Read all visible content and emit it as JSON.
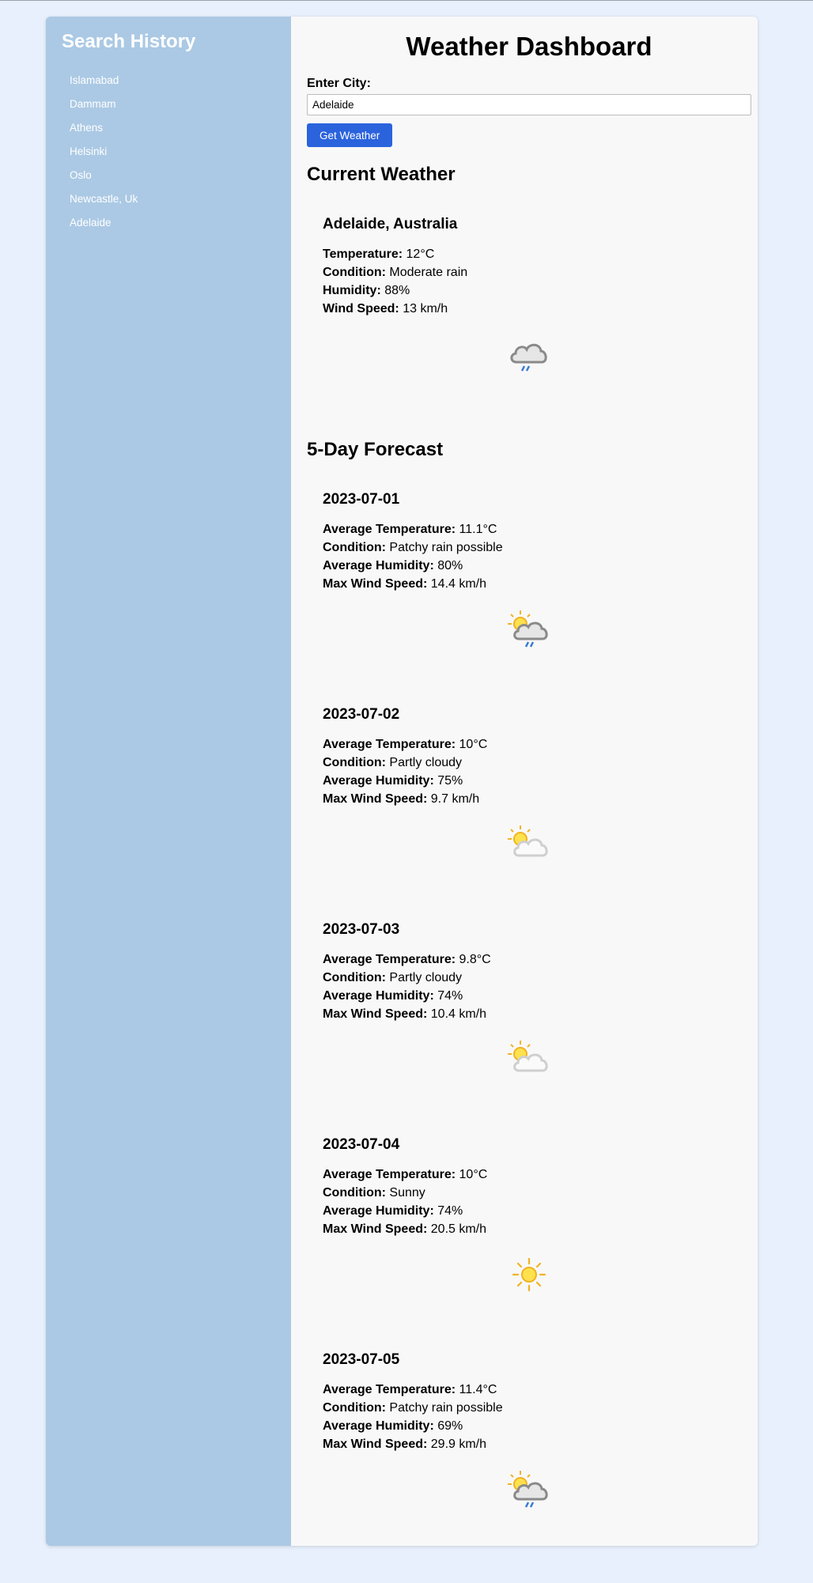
{
  "sidebar": {
    "title": "Search History",
    "items": [
      "Islamabad",
      "Dammam",
      "Athens",
      "Helsinki",
      "Oslo",
      "Newcastle, Uk",
      "Adelaide"
    ]
  },
  "main": {
    "title": "Weather Dashboard",
    "city_label": "Enter City:",
    "city_value": "Adelaide",
    "button_label": "Get Weather",
    "current_title": "Current Weather",
    "forecast_title": "5-Day Forecast"
  },
  "current": {
    "location": "Adelaide, Australia",
    "temperature_label": "Temperature:",
    "temperature": "12°C",
    "condition_label": "Condition:",
    "condition": "Moderate rain",
    "humidity_label": "Humidity:",
    "humidity": "88%",
    "wind_label": "Wind Speed:",
    "wind": "13 km/h",
    "icon": "rain-cloud-icon"
  },
  "forecast_labels": {
    "temp": "Average Temperature:",
    "condition": "Condition:",
    "humidity": "Average Humidity:",
    "wind": "Max Wind Speed:"
  },
  "forecast": [
    {
      "date": "2023-07-01",
      "temp": "11.1°C",
      "condition": "Patchy rain possible",
      "humidity": "80%",
      "wind": "14.4 km/h",
      "icon": "sun-cloud-rain-icon"
    },
    {
      "date": "2023-07-02",
      "temp": "10°C",
      "condition": "Partly cloudy",
      "humidity": "75%",
      "wind": "9.7 km/h",
      "icon": "partly-cloudy-icon"
    },
    {
      "date": "2023-07-03",
      "temp": "9.8°C",
      "condition": "Partly cloudy",
      "humidity": "74%",
      "wind": "10.4 km/h",
      "icon": "partly-cloudy-icon"
    },
    {
      "date": "2023-07-04",
      "temp": "10°C",
      "condition": "Sunny",
      "humidity": "74%",
      "wind": "20.5 km/h",
      "icon": "sun-icon"
    },
    {
      "date": "2023-07-05",
      "temp": "11.4°C",
      "condition": "Patchy rain possible",
      "humidity": "69%",
      "wind": "29.9 km/h",
      "icon": "sun-cloud-rain-icon"
    }
  ],
  "colors": {
    "sidebar_bg": "#abc9e4",
    "button_bg": "#2b63dd",
    "page_bg": "#e7f0fc"
  }
}
